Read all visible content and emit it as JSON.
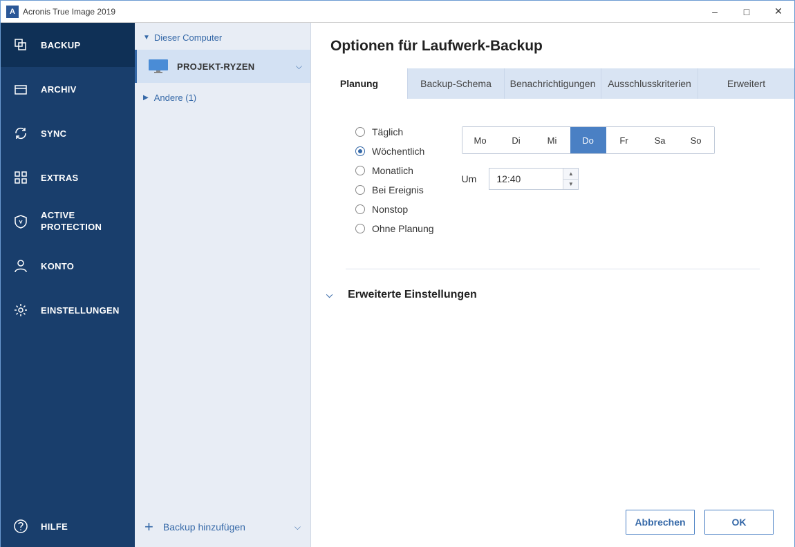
{
  "titlebar": {
    "title": "Acronis True Image 2019",
    "logo_letter": "A"
  },
  "sidebar": {
    "items": [
      {
        "label": "BACKUP"
      },
      {
        "label": "ARCHIV"
      },
      {
        "label": "SYNC"
      },
      {
        "label": "EXTRAS"
      },
      {
        "label": "ACTIVE PROTECTION"
      },
      {
        "label": "KONTO"
      },
      {
        "label": "EINSTELLUNGEN"
      }
    ],
    "help": "HILFE"
  },
  "listpanel": {
    "group_header": "Dieser Computer",
    "backup_name": "PROJEKT-RYZEN",
    "other_label": "Andere (1)",
    "add_backup": "Backup hinzufügen"
  },
  "content_header": "Optionen für Laufwerk-Backup",
  "tabs": [
    {
      "label": "Planung"
    },
    {
      "label": "Backup-Schema"
    },
    {
      "label": "Benachrichtigungen"
    },
    {
      "label": "Ausschlusskriterien"
    },
    {
      "label": "Erweitert"
    }
  ],
  "schedule": {
    "radios": [
      {
        "label": "Täglich"
      },
      {
        "label": "Wöchentlich"
      },
      {
        "label": "Monatlich"
      },
      {
        "label": "Bei Ereignis"
      },
      {
        "label": "Nonstop"
      },
      {
        "label": "Ohne Planung"
      }
    ],
    "selected_radio": 1,
    "days": [
      "Mo",
      "Di",
      "Mi",
      "Do",
      "Fr",
      "Sa",
      "So"
    ],
    "selected_day_index": 3,
    "at_label": "Um",
    "time_value": "12:40"
  },
  "advanced_label": "Erweiterte Einstellungen",
  "footer": {
    "cancel": "Abbrechen",
    "ok": "OK"
  }
}
